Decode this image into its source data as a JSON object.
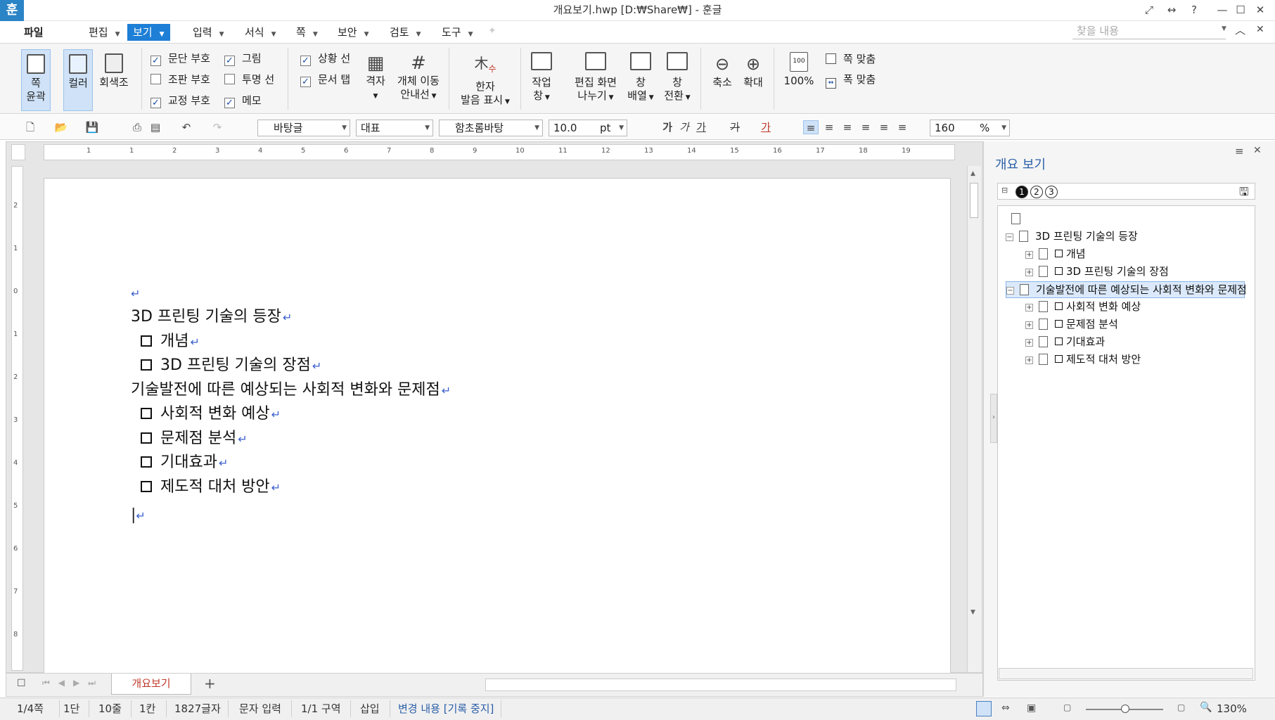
{
  "app": {
    "icon_letter": "훈",
    "title": "개요보기.hwp [D:₩Share₩] - 훈글"
  },
  "menu": {
    "file": "파일",
    "items": [
      "편집",
      "보기",
      "입력",
      "서식",
      "쪽",
      "보안",
      "검토",
      "도구"
    ],
    "active": "보기",
    "search_placeholder": "찾을 내용"
  },
  "ribbon": {
    "page_outline": [
      "쪽",
      "윤곽"
    ],
    "color": "컬러",
    "grayscale": "회색조",
    "checks_col1": [
      {
        "label": "문단 부호",
        "checked": true
      },
      {
        "label": "조판 부호",
        "checked": false
      },
      {
        "label": "교정 부호",
        "checked": true
      }
    ],
    "checks_col2": [
      {
        "label": "그림",
        "checked": true
      },
      {
        "label": "투명 선",
        "checked": false
      },
      {
        "label": "메모",
        "checked": true
      }
    ],
    "checks_col3": [
      {
        "label": "상황 선",
        "checked": true
      },
      {
        "label": "문서 탭",
        "checked": true
      }
    ],
    "grid": "격자",
    "object_move": [
      "개체 이동",
      "안내선"
    ],
    "hanja": [
      "한자",
      "발음 표시"
    ],
    "task": [
      "작업",
      "창"
    ],
    "split": [
      "편집 화면",
      "나누기"
    ],
    "arrange": [
      "창",
      "배열"
    ],
    "switch": [
      "창",
      "전환"
    ],
    "zoom_out": "축소",
    "zoom_in": "확대",
    "zoom100": "100%",
    "page_fit": "쪽 맞춤",
    "width_fit": "폭 맞춤"
  },
  "format": {
    "style": "바탕글",
    "outline": "대표",
    "font": "함초롬바탕",
    "size": "10.0",
    "unit": "pt",
    "zoom": "160",
    "zoom_unit": "%"
  },
  "ruler": {
    "h": [
      "1",
      "1",
      "2",
      "3",
      "4",
      "5",
      "6",
      "7",
      "8",
      "9",
      "10",
      "11",
      "12",
      "13",
      "14",
      "15",
      "16",
      "17",
      "18",
      "19"
    ],
    "v": [
      "2",
      "1",
      "0",
      "1",
      "2",
      "3",
      "4",
      "5",
      "6",
      "7",
      "8"
    ]
  },
  "document": {
    "lines": [
      {
        "text": "3D 프린팅 기술의 등장",
        "bullet": false
      },
      {
        "text": "개념",
        "bullet": true
      },
      {
        "text": "3D 프린팅 기술의 장점",
        "bullet": true
      },
      {
        "text": "기술발전에 따른 예상되는 사회적 변화와 문제점",
        "bullet": false
      },
      {
        "text": "사회적 변화 예상",
        "bullet": true
      },
      {
        "text": "문제점 분석",
        "bullet": true
      },
      {
        "text": "기대효과",
        "bullet": true
      },
      {
        "text": "제도적 대처 방안",
        "bullet": true
      }
    ]
  },
  "tabs": {
    "sheet": "개요보기",
    "add": "+"
  },
  "panel": {
    "title": "개요 보기",
    "levels": [
      "1",
      "2",
      "3"
    ],
    "tree": [
      {
        "text": "",
        "level": 0
      },
      {
        "text": "3D 프린팅 기술의 등장",
        "level": 1
      },
      {
        "text": "개념",
        "level": 2
      },
      {
        "text": "3D 프린팅 기술의 장점",
        "level": 2
      },
      {
        "text": "기술발전에 따른 예상되는 사회적 변화와 문제점",
        "level": 1
      },
      {
        "text": "사회적 변화 예상",
        "level": 2
      },
      {
        "text": "문제점 분석",
        "level": 2
      },
      {
        "text": "기대효과",
        "level": 2
      },
      {
        "text": "제도적 대처 방안",
        "level": 2
      }
    ]
  },
  "status": {
    "page": "1/4쪽",
    "col": "1단",
    "line": "10줄",
    "char": "1칸",
    "count": "1827글자",
    "mode": "문자 입력",
    "section": "1/1 구역",
    "insert": "삽입",
    "track": "변경 내용 [기록 중지]",
    "zoom": "130%"
  }
}
